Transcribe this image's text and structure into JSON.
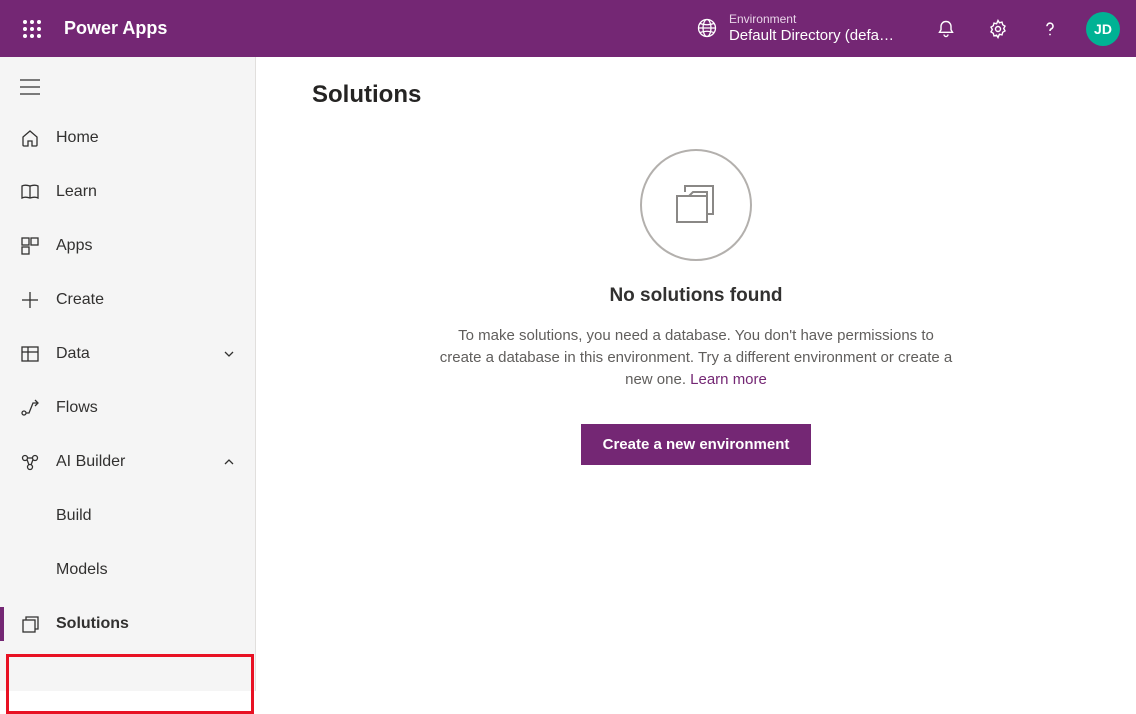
{
  "header": {
    "app_title": "Power Apps",
    "environment_label": "Environment",
    "environment_name": "Default Directory (defa…",
    "avatar_initials": "JD"
  },
  "sidebar": {
    "items": {
      "home": "Home",
      "learn": "Learn",
      "apps": "Apps",
      "create": "Create",
      "data": "Data",
      "flows": "Flows",
      "ai_builder": "AI Builder",
      "ai_build": "Build",
      "ai_models": "Models",
      "solutions": "Solutions"
    }
  },
  "main": {
    "page_title": "Solutions",
    "empty_title": "No solutions found",
    "empty_text": "To make solutions, you need a database. You don't have permissions to create a database in this environment. Try a different environment or create a new one. ",
    "learn_more": "Learn more",
    "primary_button": "Create a new environment"
  },
  "colors": {
    "brand": "#742774",
    "avatar_bg": "#00b294",
    "highlight": "#e81123"
  }
}
